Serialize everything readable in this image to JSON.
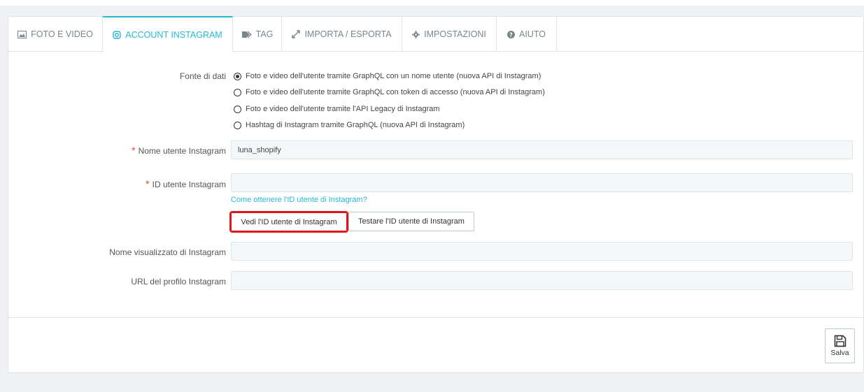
{
  "tabs": [
    {
      "label": "FOTO E VIDEO",
      "icon": "image-icon"
    },
    {
      "label": "ACCOUNT INSTAGRAM",
      "icon": "instagram-icon"
    },
    {
      "label": "TAG",
      "icon": "tag-icon"
    },
    {
      "label": "IMPORTA / ESPORTA",
      "icon": "import-export-icon"
    },
    {
      "label": "IMPOSTAZIONI",
      "icon": "gear-icon"
    },
    {
      "label": "AIUTO",
      "icon": "help-icon"
    }
  ],
  "active_tab": "ACCOUNT INSTAGRAM",
  "colors": {
    "accent": "#25b9d7",
    "required": "#e04a3a",
    "highlight": "#e0161b"
  },
  "form": {
    "data_source": {
      "label": "Fonte di dati",
      "options": [
        "Foto e video dell'utente tramite GraphQL con un nome utente (nuova API di Instagram)",
        "Foto e video dell'utente tramite GraphQL con token di accesso (nuova API di Instagram)",
        "Foto e video dell'utente tramite l'API Legacy di Instagram",
        "Hashtag di Instagram tramite GraphQL (nuova API di Instagram)"
      ],
      "selected_index": 0
    },
    "username": {
      "required_mark": "*",
      "label": "Nome utente Instagram",
      "value": "luna_shopify"
    },
    "user_id": {
      "required_mark": "*",
      "label": "ID utente Instagram",
      "value": "",
      "help_link": "Come ottenere l'ID utente di Instagram?"
    },
    "buttons": {
      "view_id": "Vedi l'ID utente di Instagram",
      "test_id": "Testare l'ID utente di Instagram"
    },
    "display_name": {
      "label": "Nome visualizzato di Instagram",
      "value": ""
    },
    "profile_url": {
      "label": "URL del profilo Instagram",
      "value": ""
    }
  },
  "footer": {
    "save_label": "Salva",
    "save_icon": "floppy-disk-icon"
  }
}
